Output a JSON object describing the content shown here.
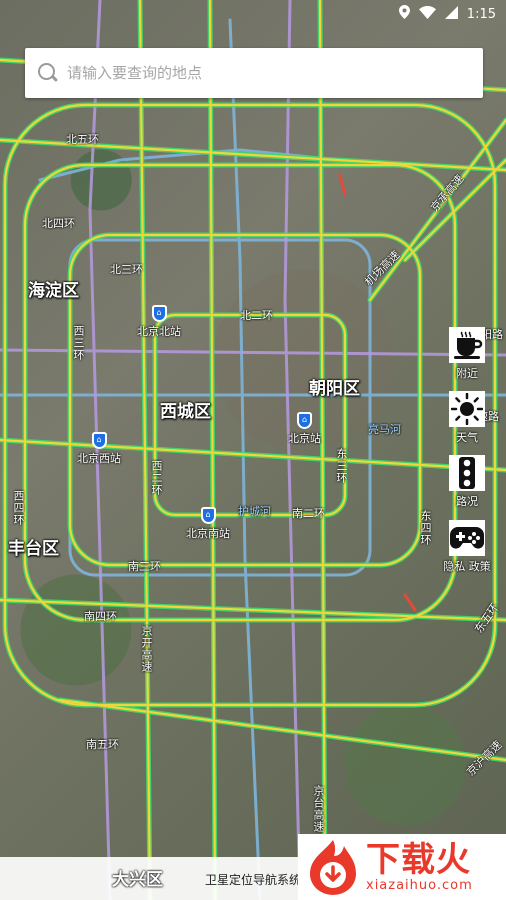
{
  "status_bar": {
    "time": "1:15",
    "icons": [
      "location-icon",
      "wifi-icon",
      "signal-icon"
    ]
  },
  "search": {
    "placeholder": "请输入要查询的地点",
    "value": ""
  },
  "map": {
    "districts": {
      "haidian": "海淀区",
      "xicheng": "西城区",
      "chaoyang": "朝阳区",
      "fengtai": "丰台区",
      "daxing": "大兴区"
    },
    "roads": {
      "north5": "北五环",
      "north4": "北四环",
      "north3": "北三环",
      "north2": "北二环",
      "west3": "西三环",
      "west4": "西四环",
      "west2": "西二环",
      "east3": "东三环",
      "east4": "东四环",
      "east5": "东五环",
      "south2": "南二环",
      "south3": "南三环",
      "south4": "南四环",
      "south5": "南五环",
      "airport_expwy": "机场高速",
      "jingcheng": "京承高速",
      "jingkai": "京开高速",
      "jingtai": "京台高速",
      "moat": "护城河",
      "liangma": "亮马河",
      "jinghu": "京沪高速",
      "chaoyang_rd": "朝阳路",
      "kuaisu": "快速路"
    },
    "stations": {
      "beijing_north": "北京北站",
      "beijing_west": "北京西站",
      "beijing": "北京站",
      "beijing_south": "北京南站"
    }
  },
  "side_buttons": [
    {
      "label": "附近",
      "icon": "coffee-cup-icon"
    },
    {
      "label": "天气",
      "icon": "sun-icon"
    },
    {
      "label": "路况",
      "icon": "traffic-light-icon"
    },
    {
      "label": "隐私 政策",
      "icon": "gamepad-icon"
    }
  ],
  "bottom": {
    "district": "大兴区",
    "caption": "卫星定位导航系统"
  },
  "watermark": {
    "brand_cn": "下载火",
    "brand_en": "xiazaihuo.com"
  },
  "colors": {
    "road_green": "#3fdc6a",
    "road_yellow": "#f2d53a",
    "transit_blue": "#7fb8e0",
    "transit_purple": "#b69ae0",
    "watermark_red": "#e8392a"
  }
}
